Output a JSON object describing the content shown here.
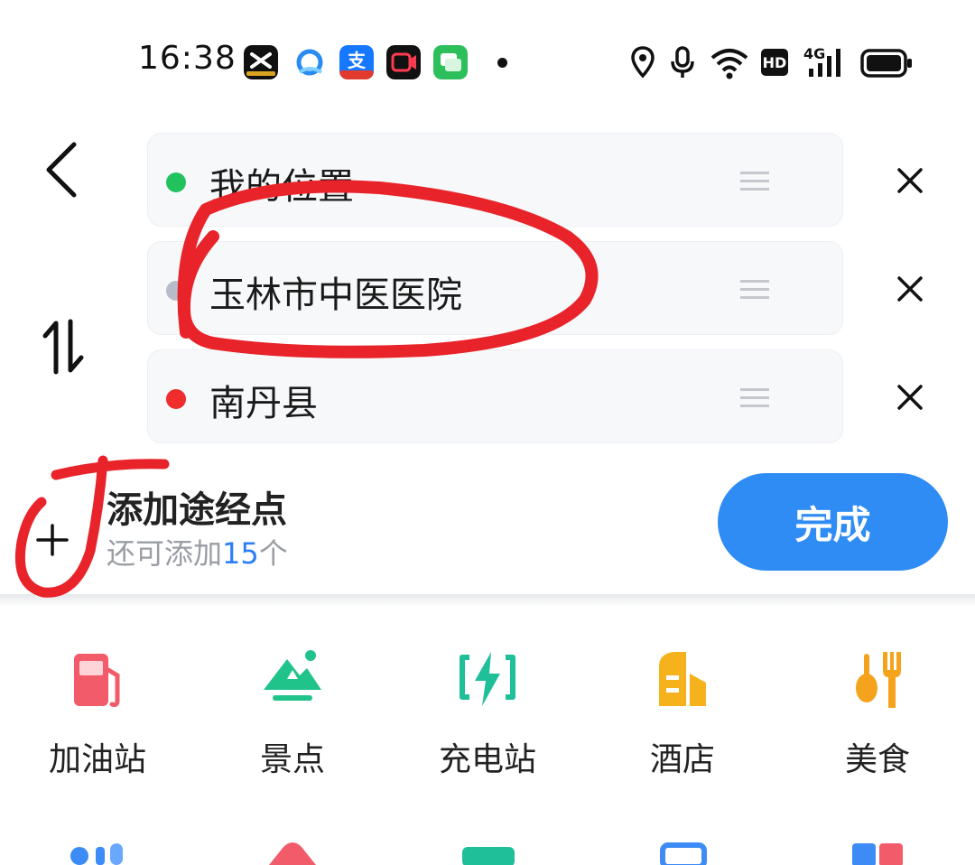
{
  "status_bar": {
    "time": "16:38",
    "app_icons": [
      "capcut-icon",
      "qq-browser-icon",
      "alipay-icon",
      "video-recorder-icon",
      "messages-icon"
    ],
    "network_label": "4G",
    "hd_label": "HD"
  },
  "route": {
    "start": {
      "label": "我的位置",
      "dot_color": "#22c35e"
    },
    "waypoint": {
      "label": "玉林市中医医院",
      "dot_color": "#b7bcc8"
    },
    "destination": {
      "label": "南丹县",
      "dot_color": "#f02c2c"
    }
  },
  "add_waypoint": {
    "title": "添加途经点",
    "subtitle_prefix": "还可添加",
    "subtitle_count": "15",
    "subtitle_suffix": "个"
  },
  "done_button": {
    "label": "完成",
    "color": "#2f8cf5"
  },
  "categories": [
    {
      "label": "加油站",
      "icon": "gas-station-icon",
      "color": "#f25b6a"
    },
    {
      "label": "景点",
      "icon": "scenic-spot-icon",
      "color": "#20c48a"
    },
    {
      "label": "充电站",
      "icon": "charging-station-icon",
      "color": "#1fbf9a"
    },
    {
      "label": "酒店",
      "icon": "hotel-icon",
      "color": "#f5b21c"
    },
    {
      "label": "美食",
      "icon": "food-icon",
      "color": "#f5a31c"
    }
  ],
  "annotation_color": "#e8232a"
}
